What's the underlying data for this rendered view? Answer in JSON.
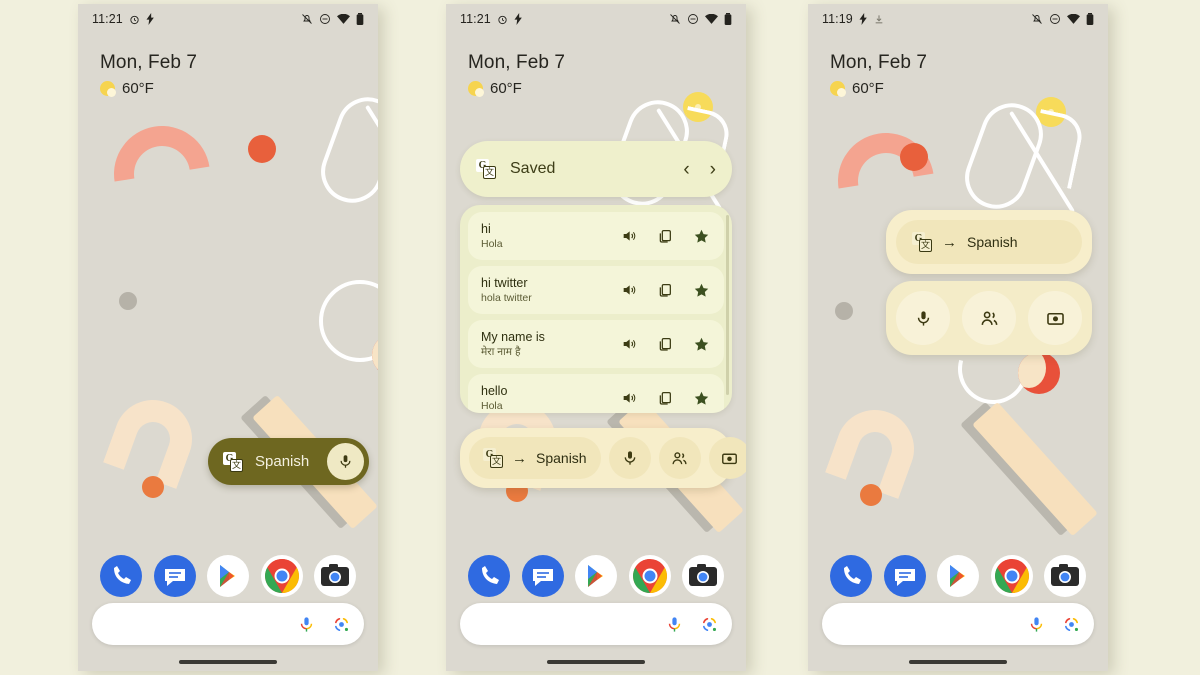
{
  "background_color": "#f1f0dd",
  "phone_screen_color": "#dcd9d0",
  "accent_olive": "#6e6720",
  "accent_cream": "#f7eecb",
  "accent_pale_green": "#eff0cc",
  "panels": [
    {
      "id": "panel-1",
      "status": {
        "time": "11:21",
        "icons_left": [
          "alarm-icon",
          "bolt-icon"
        ],
        "icons_right": [
          "notifications-off-icon",
          "dnd-icon",
          "wifi-icon",
          "battery-icon"
        ]
      },
      "clock": {
        "date": "Mon, Feb 7",
        "temperature": "60°F",
        "weather_icon": "sun-icon"
      },
      "translate_pill": {
        "icon": "google-translate-icon",
        "label": "Spanish",
        "mic_icon": "microphone-icon"
      }
    },
    {
      "id": "panel-2",
      "status": {
        "time": "11:21",
        "icons_left": [
          "alarm-icon",
          "bolt-icon"
        ],
        "icons_right": [
          "notifications-off-icon",
          "dnd-icon",
          "wifi-icon",
          "battery-icon"
        ]
      },
      "clock": {
        "date": "Mon, Feb 7",
        "temperature": "60°F",
        "weather_icon": "sun-icon"
      },
      "saved_card": {
        "icon": "google-translate-icon",
        "title": "Saved",
        "prev_label": "‹",
        "next_label": "›",
        "rows": [
          {
            "source": "hi",
            "target": "Hola"
          },
          {
            "source": "hi twitter",
            "target": "hola twitter"
          },
          {
            "source": "My name is",
            "target": "मेरा नाम है"
          },
          {
            "source": "hello",
            "target": "Hola"
          }
        ],
        "row_actions": [
          "speaker-icon",
          "copy-icon",
          "star-icon"
        ]
      },
      "translate_bar": {
        "icon": "google-translate-icon",
        "arrow": "→",
        "language": "Spanish",
        "buttons": [
          "microphone-icon",
          "conversation-icon",
          "camera-icon"
        ]
      }
    },
    {
      "id": "panel-3",
      "status": {
        "time": "11:19",
        "icons_left": [
          "bolt-icon",
          "download-icon"
        ],
        "icons_right": [
          "notifications-off-icon",
          "dnd-icon",
          "wifi-icon",
          "battery-icon"
        ]
      },
      "clock": {
        "date": "Mon, Feb 7",
        "temperature": "60°F",
        "weather_icon": "sun-icon"
      },
      "widget": {
        "icon": "google-translate-icon",
        "arrow": "→",
        "language": "Spanish",
        "buttons": [
          "microphone-icon",
          "conversation-icon",
          "camera-icon"
        ]
      }
    }
  ],
  "dock": {
    "apps": [
      "phone-app-icon",
      "messages-app-icon",
      "play-store-app-icon",
      "chrome-app-icon",
      "camera-app-icon"
    ]
  },
  "search": {
    "logo": "google-g-icon",
    "placeholder": "",
    "value": "",
    "mic_icon": "google-mic-icon",
    "lens_icon": "google-lens-icon"
  },
  "translate_glyph": {
    "letter": "G",
    "char": "文"
  }
}
